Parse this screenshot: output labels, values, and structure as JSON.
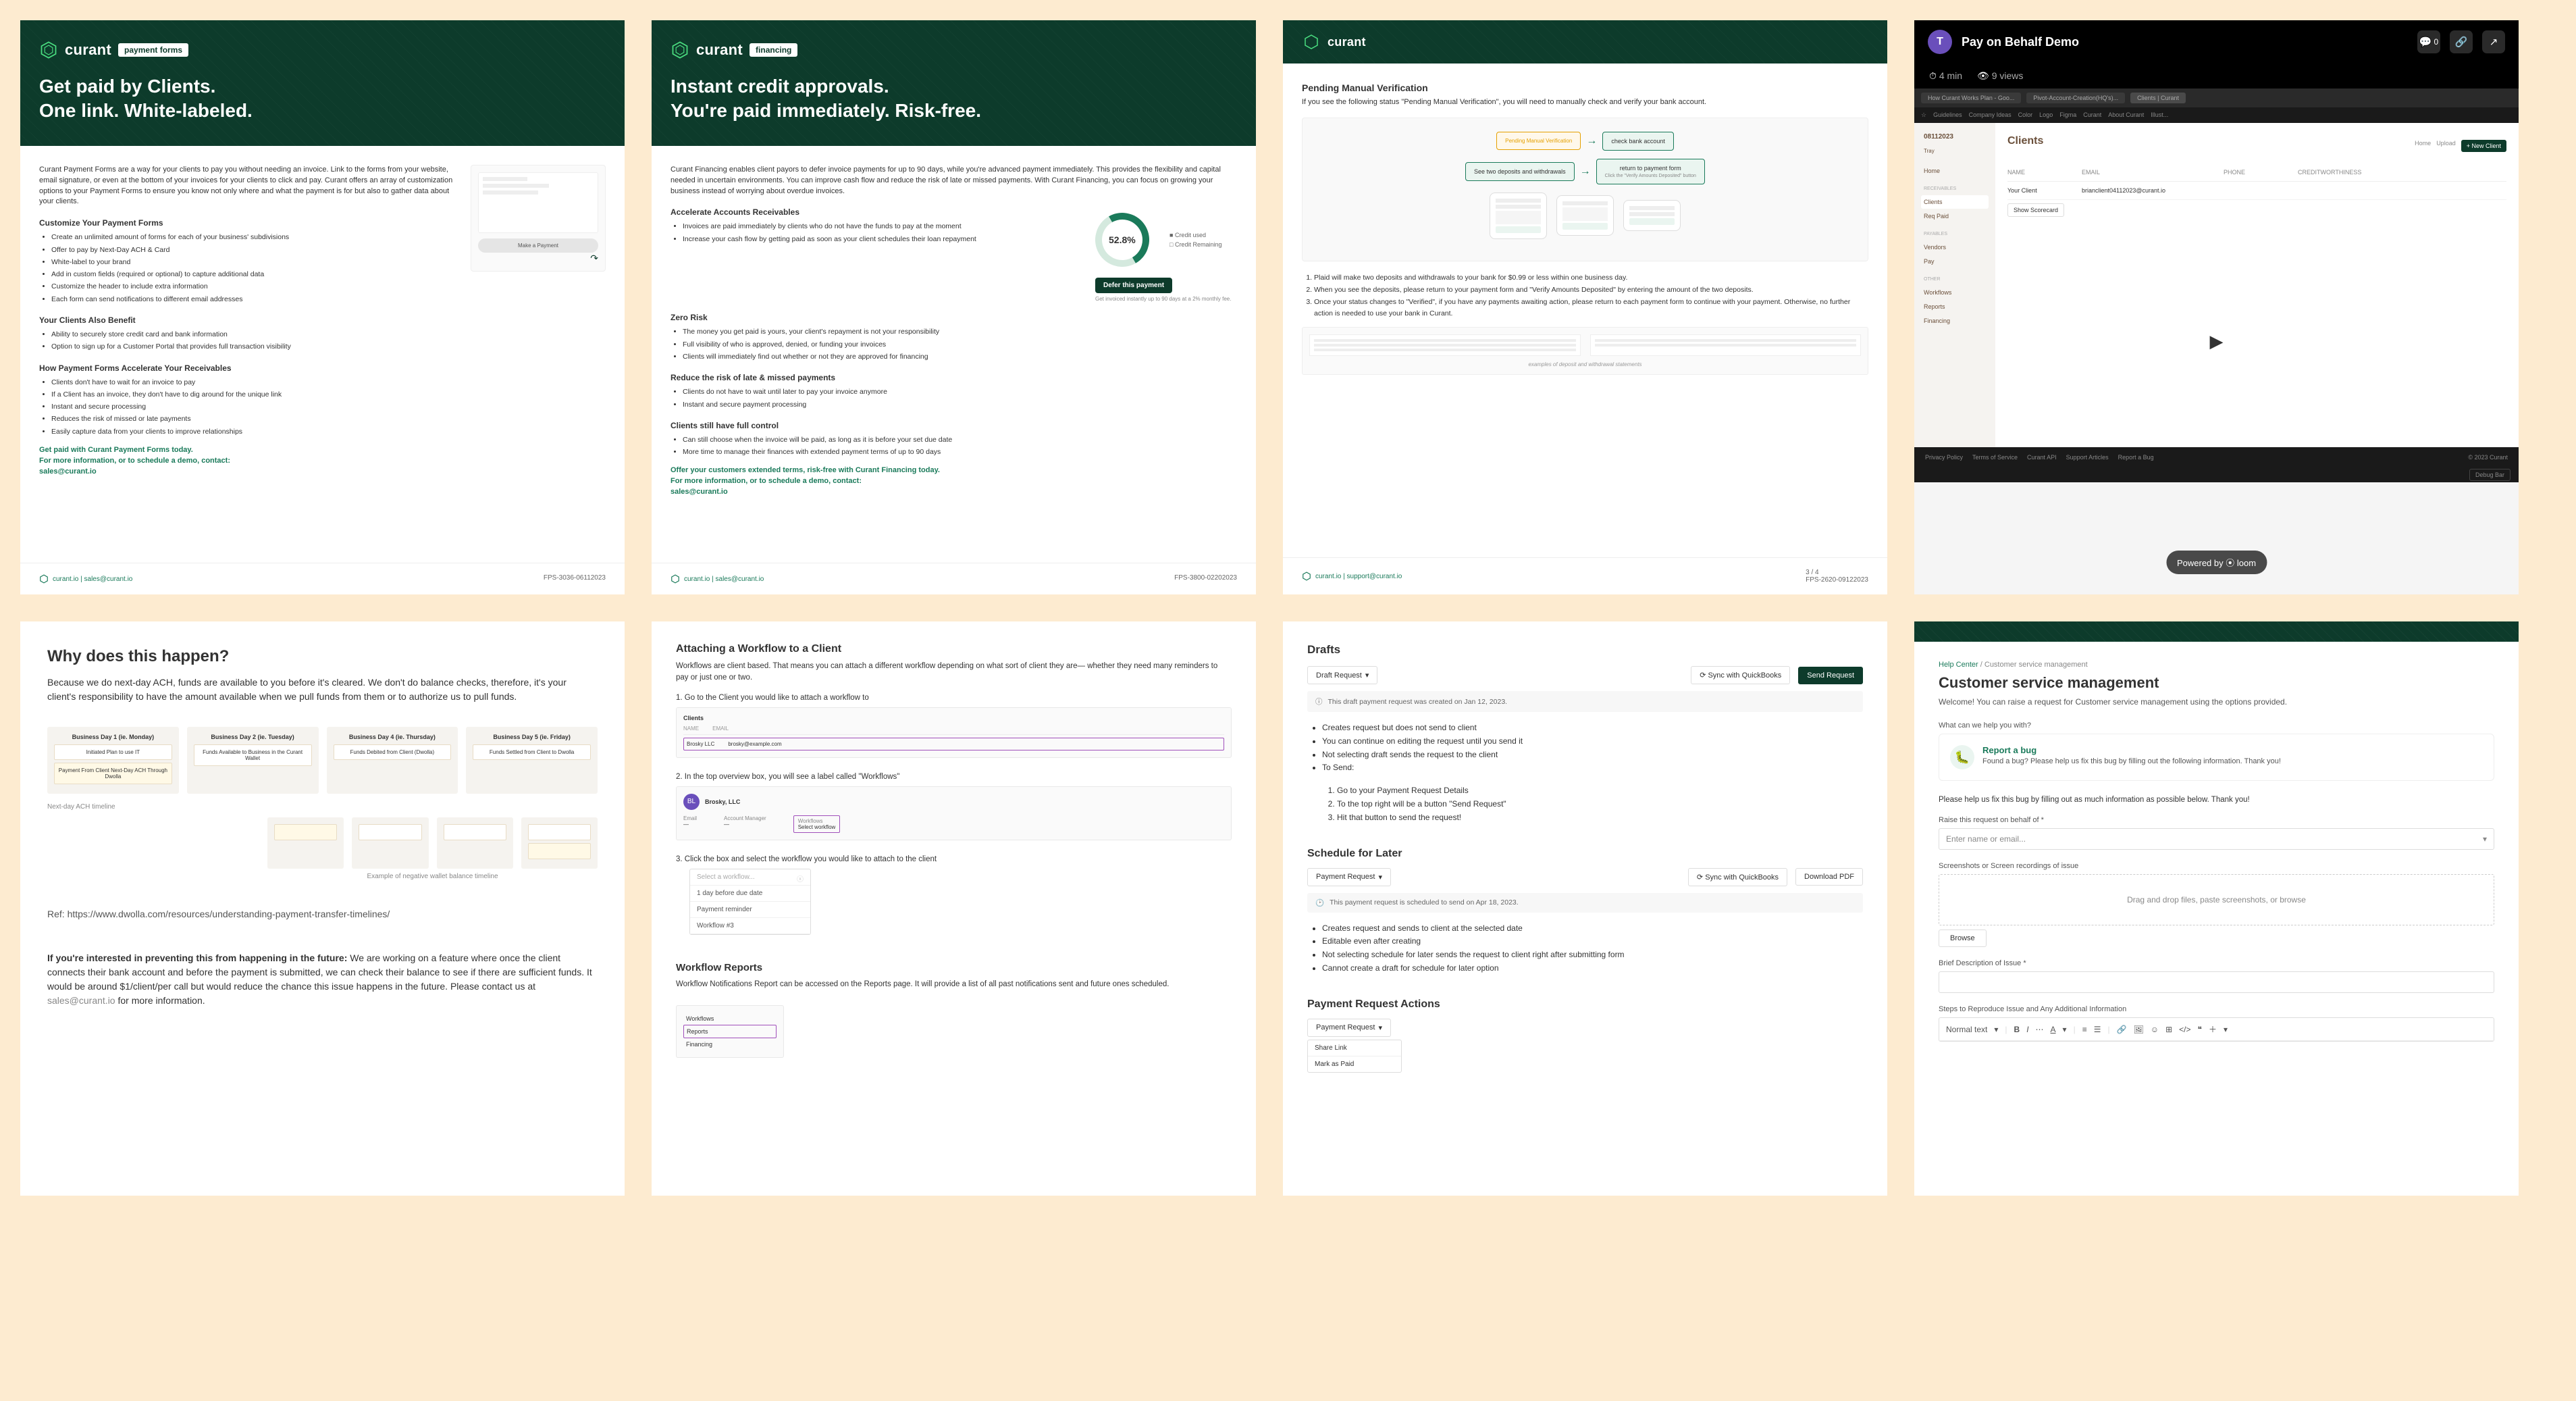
{
  "brand": "curant",
  "card1": {
    "tag": "payment forms",
    "h1a": "Get paid by Clients.",
    "h1b": "One link. White-labeled.",
    "intro": "Curant Payment Forms are a way for your clients to pay you without needing an invoice. Link to the forms from your website, email signature, or even at the bottom of your invoices for your clients to click and pay. Curant offers an array of customization options to your Payment Forms to ensure you know not only where and what the payment is for but also to gather data about your clients.",
    "h3a": "Customize Your Payment Forms",
    "bulletsA": [
      "Create an unlimited amount of forms for each of your business' subdivisions",
      "Offer to pay by Next-Day ACH & Card",
      "White-label to your brand",
      "Add in custom fields (required or optional) to capture additional data",
      "Customize the header to include extra information",
      "Each form can send notifications to different email addresses"
    ],
    "h3b": "Your Clients Also Benefit",
    "bulletsB": [
      "Ability to securely store credit card and bank information",
      "Option to sign up for a Customer Portal that provides full transaction visibility"
    ],
    "h3c": "How Payment Forms Accelerate Your Receivables",
    "bulletsC": [
      "Clients don't have to wait for an invoice to pay",
      "If a Client has an invoice, they don't have to dig around for the unique link",
      "Instant and secure processing",
      "Reduces the risk of missed or late payments",
      "Easily capture data from your clients to improve relationships"
    ],
    "ctaA": "Get paid with Curant Payment Forms today.",
    "ctaB": "For more information, or to schedule a demo, contact:",
    "ctaC": "sales@curant.io",
    "mockBtn": "Make a Payment",
    "foot": "curant.io | sales@curant.io",
    "rev": "FPS-3036-06112023"
  },
  "card2": {
    "tag": "financing",
    "h1a": "Instant credit approvals.",
    "h1b": "You're paid immediately. Risk-free.",
    "intro": "Curant Financing enables client payors to defer invoice payments for up to 90 days, while you're advanced payment immediately. This provides the flexibility and capital needed in uncertain environments. You can improve cash flow and reduce the risk of late or missed payments. With Curant Financing, you can focus on growing your business instead of worrying about overdue invoices.",
    "h3a": "Accelerate Accounts Receivables",
    "bulletsA": [
      "Invoices are paid immediately by clients who do not have the funds to pay at the moment",
      "Increase your cash flow by getting paid as soon as your client schedules their loan repayment"
    ],
    "h3b": "Zero Risk",
    "bulletsB": [
      "The money you get paid is yours, your client's repayment is not your responsibility",
      "Full visibility of who is approved, denied, or funding your invoices",
      "Clients will immediately find out whether or not they are approved for financing"
    ],
    "h3c": "Reduce the risk of late & missed payments",
    "bulletsC": [
      "Clients do not have to wait until later to pay your invoice anymore",
      "Instant and secure payment processing"
    ],
    "h3d": "Clients still have full control",
    "bulletsD": [
      "Can still choose when the invoice will be paid, as long as it is before your set due date",
      "More time to manage their finances with extended payment terms of up to 90 days"
    ],
    "ctaA": "Offer your customers extended terms, risk-free with Curant Financing today.",
    "ctaB": "For more information, or to schedule a demo, contact:",
    "ctaC": "sales@curant.io",
    "donut": "52.8%",
    "deferLabel": "Defer this payment",
    "deferNote": "Get invoiced instantly up to 90 days at a 2% monthly fee.",
    "legendA": "Credit used",
    "legendB": "Credit Remaining",
    "foot": "curant.io | sales@curant.io",
    "rev": "FPS-3800-02202023"
  },
  "card3": {
    "h2": "Pending Manual Verification",
    "intro": "If you see the following status \"Pending Manual Verification\", you will need to manually check and verify your bank account.",
    "flow1": "Pending Manual Verification",
    "flow2": "check bank account",
    "flow3": "See two deposits and withdrawals",
    "flow4": "return to payment form",
    "flow4sub": "Click the \"Verify Amounts Deposited\" button",
    "ol": [
      "Plaid will make two deposits and withdrawals to your bank for $0.99 or less within one business day.",
      "When you see the deposits, please return to your payment form and \"Verify Amounts Deposited\" by entering the amount of the two deposits.",
      "Once your status changes to \"Verified\", if you have any payments awaiting action, please return to each payment form to continue with your payment. Otherwise, no further action is needed to use your bank in Curant."
    ],
    "statementCap": "examples of deposit and withdrawal statements",
    "foot": "curant.io | support@curant.io",
    "page": "3 / 4",
    "rev": "FPS-2620-09122023"
  },
  "card4": {
    "avatarLetter": "T",
    "title": "Pay on Behalf Demo",
    "comments": "0",
    "duration": "4 min",
    "views": "9 views",
    "tabs": [
      "How Curant Works Plan - Goo...",
      "Pivot-Account-Creation(HQ's)...",
      "Clients | Curant"
    ],
    "chrome": [
      "Guidelines",
      "Company Ideas",
      "Color",
      "Logo",
      "Figma",
      "Curant",
      "About Curant",
      "Illust..."
    ],
    "date": "08112023",
    "user": "Tray",
    "heading": "Clients",
    "navHome": "Home",
    "navRec": "RECEIVABLES",
    "navClients": "Clients",
    "navReqPaid": "Req Paid",
    "navPay": "PAYABLES",
    "navVendors": "Vendors",
    "navPayItem": "Pay",
    "navOth": "OTHER",
    "navWork": "Workflows",
    "navReports": "Reports",
    "navFin": "Financing",
    "tblName": "NAME",
    "tblEmail": "EMAIL",
    "tblPhone": "PHONE",
    "tblCredit": "CREDITWORTHINESS",
    "rowName": "Your Client",
    "rowEmail": "brianclient04112023@curant.io",
    "topHome": "Home",
    "topUpload": "Upload",
    "topNew": "+ New Client",
    "scorecard": "Show Scorecard",
    "loom": "Powered by ⦿ loom",
    "footLinks": [
      "Privacy Policy",
      "Terms of Service",
      "Curant API",
      "Support Articles",
      "Report a Bug"
    ],
    "copy": "© 2023 Curant",
    "debug": "Debug Bar"
  },
  "card5": {
    "h2": "Why does this happen?",
    "p1": "Because we do next-day ACH, funds are available to you before it's cleared. We don't do balance checks, therefore, it's your client's responsibility to have the amount available when we pull funds from them or to authorize us to pull funds.",
    "tl1h": "Business Day 1 (ie. Monday)",
    "tl1a": "Initiated Plan to use IT",
    "tl1b": "Payment From Client Next-Day ACH Through Dwolla",
    "tl2h": "Business Day 2 (ie. Tuesday)",
    "tl2a": "Funds Available to Business in the Curant Wallet",
    "tl3h": "Business Day 4 (ie. Thursday)",
    "tl3a": "Funds Debited from Client (Dwolla)",
    "tl4h": "Business Day 5 (ie. Friday)",
    "tl4a": "Funds Settled from Client to Dwolla",
    "cap1": "Next-day ACH timeline",
    "exh": "Example of negative wallet balance timeline",
    "ref": "Ref: https://www.dwolla.com/resources/understanding-payment-transfer-timelines/",
    "p2a": "If you're interested in preventing this from happening in the future:",
    "p2b": " We are working on a feature where once the client connects their bank account and before the payment is submitted, we can check their balance to see if there are sufficient funds. It would be around $1/client/per call but would reduce the chance this issue happens in the future. Please contact us at ",
    "p2c": "sales@curant.io",
    "p2d": " for more information."
  },
  "card6": {
    "h2": "Attaching a Workflow to a Client",
    "intro": "Workflows are client based. That means you can attach a different workflow depending on what sort of client they are— whether they need many reminders to pay or just one or two.",
    "s1": "1.  Go to the Client you would like to attach a workflow to",
    "clientsLabel": "Clients",
    "s2": "2.  In the top overview box, you will see a label called \"Workflows\"",
    "company": "Brosky, LLC",
    "s3": "3.  Click the box and select the workflow you would like to attach to the client",
    "ddPlaceholder": "Select a workflow...",
    "dd1": "1 day before due date",
    "dd2": "Payment reminder",
    "dd3": "Workflow #3",
    "h3": "Workflow Reports",
    "p3": "Workflow Notifications Report can be accessed on the Reports page. It will provide a list of all past notifications sent and future ones scheduled.",
    "side1": "Workflows",
    "side2": "Reports",
    "side3": "Financing"
  },
  "card7": {
    "h2": "Drafts",
    "btnDraft": "Draft Request",
    "btnSync": "⟳ Sync with QuickBooks",
    "btnSend": "Send Request",
    "note1": "This draft payment request was created on Jan 12, 2023.",
    "bullets1": [
      "Creates request but does not send to client",
      "You can continue on editing the request until you send it",
      "Not selecting draft sends the request to the client",
      "To Send:"
    ],
    "ol1": [
      "Go to your Payment Request Details",
      "To the top right will be a button \"Send Request\"",
      "Hit that button to send the request!"
    ],
    "h3": "Schedule for Later",
    "btnPay": "Payment Request",
    "btnSync2": "⟳ Sync with QuickBooks",
    "btnDl": "Download PDF",
    "note2": "This payment request is scheduled to send on Apr 18, 2023.",
    "bullets2": [
      "Creates request and sends to client at the selected date",
      "Editable even after creating",
      "Not selecting schedule for later sends the request to client right after submitting form",
      "Cannot create a draft for schedule for later option"
    ],
    "h4": "Payment Request Actions",
    "btnPay2": "Payment Request",
    "act1": "Share Link",
    "act2": "Mark as Paid"
  },
  "card8": {
    "crumbA": "Help Center",
    "crumbB": "Customer service management",
    "h2": "Customer service management",
    "intro": "Welcome! You can raise a request for Customer service management using the options provided.",
    "q": "What can we help you with?",
    "bugTitle": "Report a bug",
    "bugDesc": "Found a bug? Please help us fix this bug by filling out the following information. Thank you!",
    "help": "Please help us fix this bug by filling out as much information as possible below. Thank you!",
    "l1": "Raise this request on behalf of *",
    "ph1": "Enter name or email...",
    "l2": "Screenshots or Screen recordings of issue",
    "drop": "Drag and drop files, paste screenshots, or browse",
    "browse": "Browse",
    "l3": "Brief Description of Issue *",
    "l4": "Steps to Reproduce Issue and Any Additional Information",
    "rteNormal": "Normal text"
  }
}
